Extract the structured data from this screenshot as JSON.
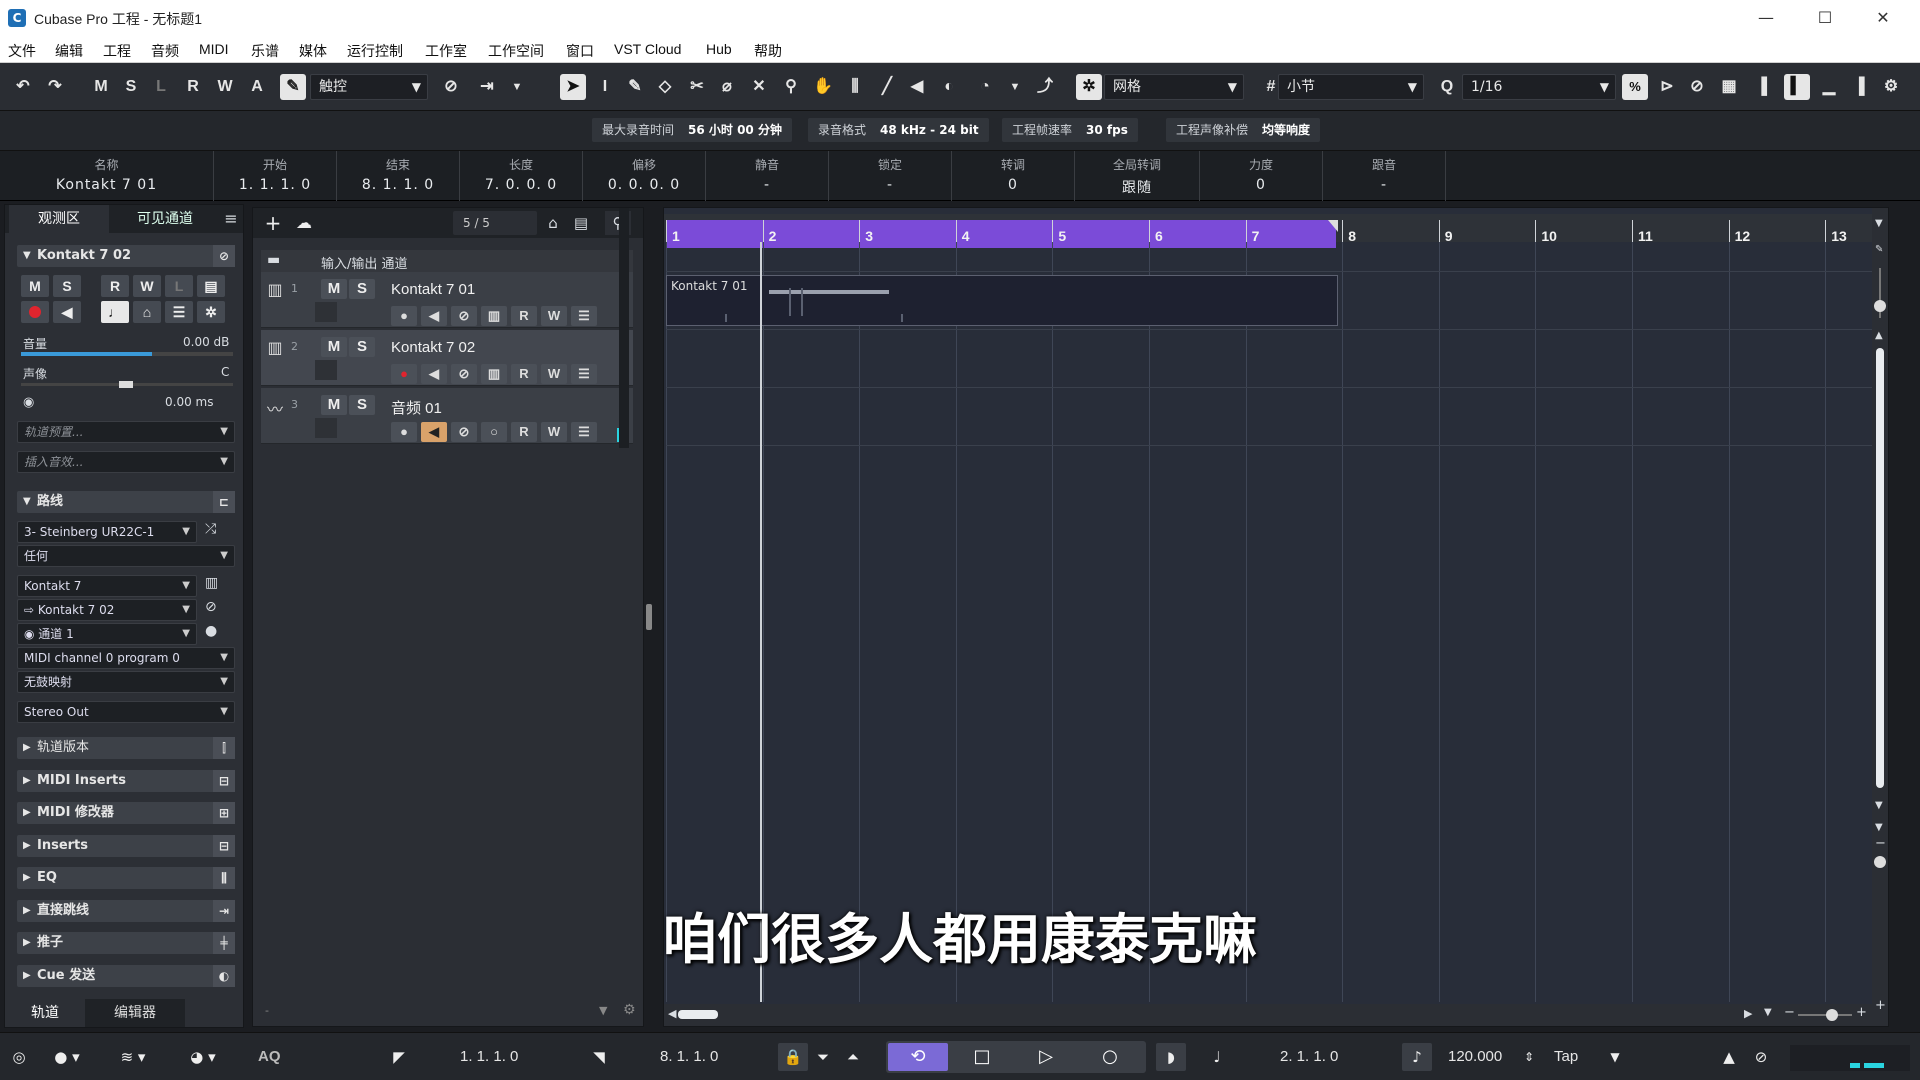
{
  "window": {
    "title": "Cubase Pro 工程 - 无标题1",
    "icon": "cubase-logo-icon"
  },
  "menu": [
    "文件",
    "编辑",
    "工程",
    "音频",
    "MIDI",
    "乐谱",
    "媒体",
    "运行控制",
    "工作室",
    "工作空间",
    "窗口",
    "VST Cloud",
    "Hub",
    "帮助"
  ],
  "toolbar": {
    "undo_icon": "↶",
    "redo_icon": "↷",
    "state_buttons": [
      "M",
      "S",
      "L",
      "R",
      "W",
      "A"
    ],
    "automation_mode": "触控",
    "snap_type": "网格",
    "grid_type": "小节",
    "quantize": "1/16"
  },
  "status": {
    "max_rec_label": "最大录音时间",
    "max_rec_value": "56 小时 00 分钟",
    "rec_format_label": "录音格式",
    "rec_format_value": "48 kHz - 24 bit",
    "frame_rate_label": "工程帧速率",
    "frame_rate_value": "30 fps",
    "pan_law_label": "工程声像补偿",
    "pan_law_value": "均等响度"
  },
  "infoline": [
    {
      "h": "名称",
      "v": "Kontakt 7 01"
    },
    {
      "h": "开始",
      "v": "1. 1. 1.   0"
    },
    {
      "h": "结束",
      "v": "8. 1. 1.   0"
    },
    {
      "h": "长度",
      "v": "7. 0. 0.   0"
    },
    {
      "h": "偏移",
      "v": "0. 0. 0.   0"
    },
    {
      "h": "静音",
      "v": "-"
    },
    {
      "h": "锁定",
      "v": "-"
    },
    {
      "h": "转调",
      "v": "0"
    },
    {
      "h": "全局转调",
      "v": "跟随"
    },
    {
      "h": "力度",
      "v": "0"
    },
    {
      "h": "跟音",
      "v": "-"
    }
  ],
  "inspector": {
    "tab_inspector": "观测区",
    "tab_visible": "可见通道",
    "track_name": "Kontakt 7 02",
    "volume_label": "音量",
    "volume_value": "0.00 dB",
    "pan_label": "声像",
    "pan_value": "C",
    "delay_value": "0.00 ms",
    "track_preset": "轨道预置...",
    "insert_preset": "插入音效...",
    "routing_label": "路线",
    "midi_input": "3- Steinberg UR22C-1",
    "midi_channel_in": "任何",
    "instrument": "Kontakt 7",
    "output_track": "Kontakt 7 02",
    "channel": "通道 1",
    "program": "MIDI channel 0 program 0",
    "drum_map": "无鼓映射",
    "audio_out": "Stereo Out",
    "sections": [
      "轨道版本",
      "MIDI Inserts",
      "MIDI 修改器",
      "Inserts",
      "EQ",
      "直接跳线",
      "推子",
      "Cue 发送"
    ],
    "bottom_tab_track": "轨道",
    "bottom_tab_editor": "编辑器"
  },
  "tracklist": {
    "count": "5 / 5",
    "folder_name": "输入/输出 通道",
    "tracks": [
      {
        "num": "1",
        "name": "Kontakt 7 01",
        "type": "instrument"
      },
      {
        "num": "2",
        "name": "Kontakt 7 02",
        "type": "instrument"
      },
      {
        "num": "3",
        "name": "音频 01",
        "type": "audio"
      }
    ]
  },
  "arrange": {
    "bars": [
      "1",
      "2",
      "3",
      "4",
      "5",
      "6",
      "7",
      "8",
      "9",
      "10",
      "11",
      "12",
      "13"
    ],
    "event_name": "Kontakt 7 01",
    "cycle_color": "#7b4bd8"
  },
  "transport": {
    "left_locator": "1. 1. 1.   0",
    "right_locator": "8. 1. 1.   0",
    "position": "2. 1. 1.   0",
    "tempo": "120.000",
    "tap": "Tap",
    "aq": "AQ"
  },
  "subtitle": "咱们很多人都用康泰克嘛"
}
